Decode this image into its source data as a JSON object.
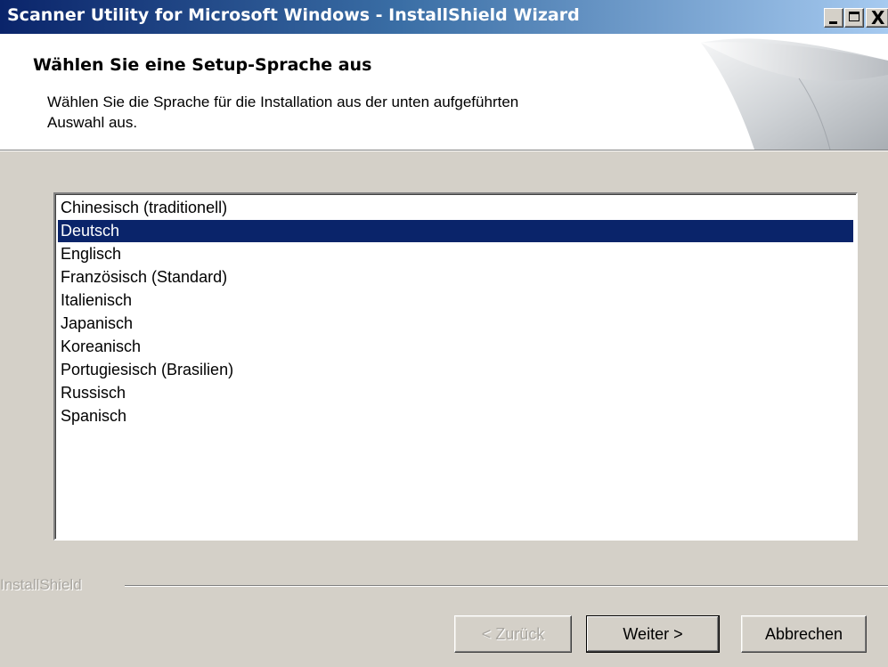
{
  "window": {
    "title": "Scanner Utility for Microsoft Windows - InstallShield Wizard",
    "controls": {
      "minimize": "minimize-icon",
      "maximize": "maximize-icon",
      "close": "close-icon",
      "close_glyph": "X"
    },
    "titlebar_colors": [
      "#0a246a",
      "#3a6ea5",
      "#a6caf0"
    ]
  },
  "banner": {
    "title": "Wählen Sie eine Setup-Sprache aus",
    "description": "Wählen Sie die Sprache für die Installation aus der unten aufgeführten Auswahl aus."
  },
  "languages": {
    "selected_index": 1,
    "selected_color": "#0a246a",
    "items": [
      "Chinesisch (traditionell)",
      "Deutsch",
      "Englisch",
      "Französisch (Standard)",
      "Italienisch",
      "Japanisch",
      "Koreanisch",
      "Portugiesisch (Brasilien)",
      "Russisch",
      "Spanisch"
    ]
  },
  "footer": {
    "brand": "InstallShield"
  },
  "buttons": {
    "back": "< Zurück",
    "next": "Weiter >",
    "cancel": "Abbrechen",
    "back_enabled": false
  }
}
